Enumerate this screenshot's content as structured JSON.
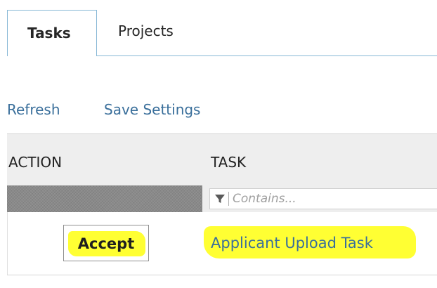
{
  "tabs": [
    {
      "label": "Tasks",
      "active": true
    },
    {
      "label": "Projects",
      "active": false
    }
  ],
  "toolbar": {
    "refresh_label": "Refresh",
    "save_settings_label": "Save Settings"
  },
  "grid": {
    "columns": [
      "ACTION",
      "TASK"
    ],
    "filter": {
      "placeholder": "Contains..."
    },
    "rows": [
      {
        "action": "Accept",
        "task": "Applicant Upload Task"
      }
    ]
  },
  "colors": {
    "accent": "#87b8d6",
    "link": "#3a6f9b",
    "highlight": "#ffff33"
  }
}
